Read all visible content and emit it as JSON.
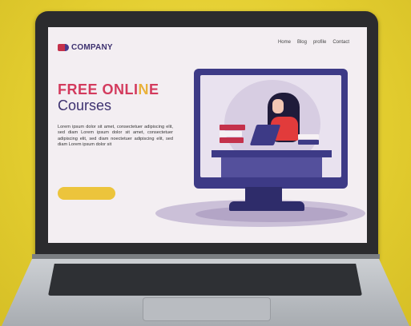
{
  "site": {
    "brand": "COMPANY",
    "nav": [
      "Home",
      "Blog",
      "profile",
      "Contact"
    ],
    "hero_title_part1": "FREE ONLI",
    "hero_title_accent": "N",
    "hero_title_part2": "E",
    "hero_subtitle": "Courses",
    "paragraph": "Lorem ipsum dolor sit amet, consectetuer adipiscing elit, sed diam Lorem ipsum dolor sit amet, consectetuer adipiscing elit, sed diam noectetuer adipiscing elit, sed diam Lorem ipsum dolor sit"
  },
  "colors": {
    "background": "#e8d43a",
    "primary": "#3d3170",
    "accent_red": "#d33a5d",
    "accent_yellow": "#ecc43c"
  }
}
